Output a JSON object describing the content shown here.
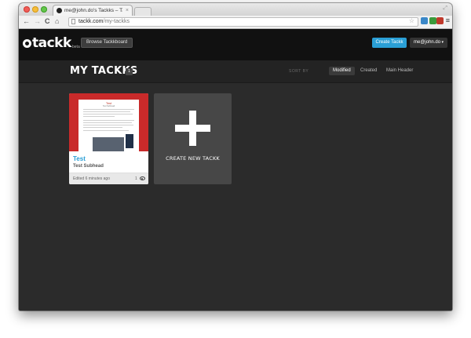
{
  "browser": {
    "tab_title": "me@john.do's Tackks – Tack",
    "tab_close": "×",
    "url_host": "tackk.com",
    "url_path": "/my-tackks",
    "back": "←",
    "forward": "→",
    "reload": "C",
    "home": "⌂",
    "star": "☆",
    "menu": "≡",
    "resize": "⤢"
  },
  "header": {
    "logo": "tackk",
    "beta": "beta",
    "browse_label": "Browse Tackkboard",
    "create_label": "Create Tackk",
    "user_label": "me@john.do",
    "user_chevron": "▾"
  },
  "title_bar": {
    "title": "MY TACKKS",
    "badge": "1",
    "sort_label": "SORT BY",
    "sort_options": [
      "Modified",
      "Created",
      "Main Header"
    ],
    "sort_active": "Modified"
  },
  "cards": [
    {
      "title": "Test",
      "subhead": "Test Subhead",
      "edited": "Edited 6 minutes ago",
      "views": "1",
      "thumb": {
        "title": "Test",
        "subtitle": "Test Subhead"
      }
    }
  ],
  "new_card": {
    "label": "CREATE NEW TACKK"
  },
  "colors": {
    "accent": "#2a9fd6",
    "thumb_red": "#c92a2a",
    "page_bg": "#2b2b2b",
    "header_bg": "#111111"
  }
}
